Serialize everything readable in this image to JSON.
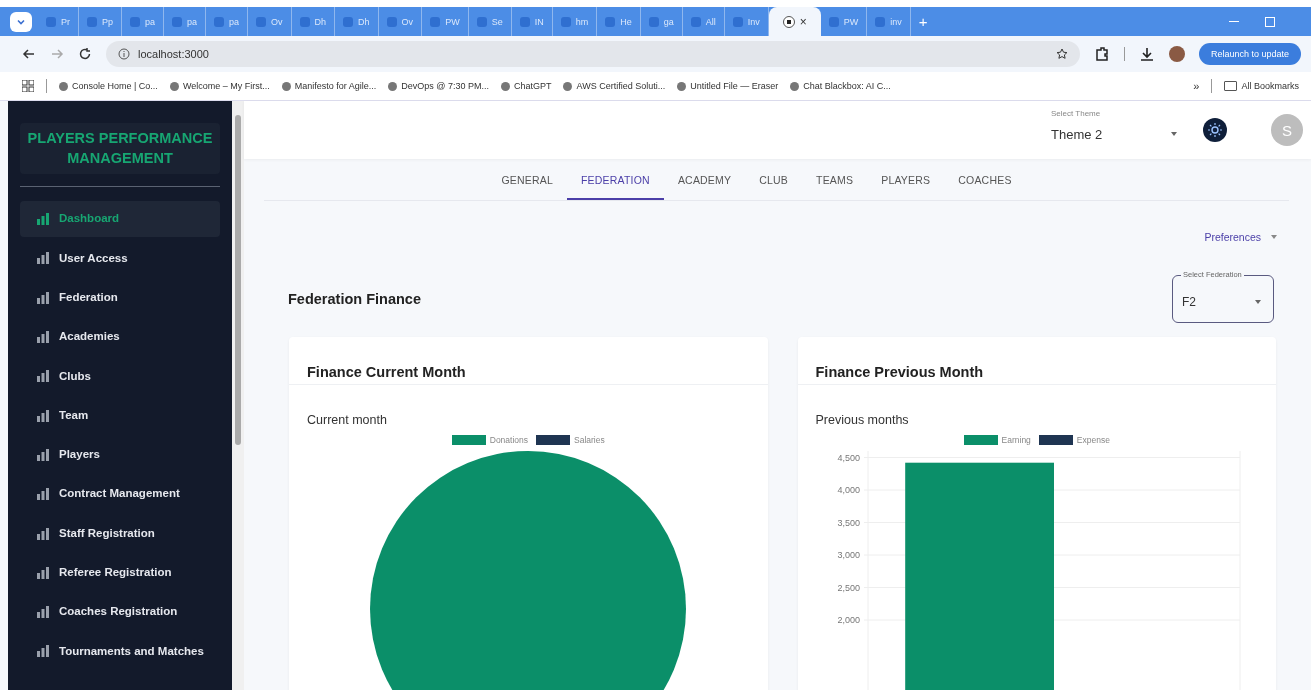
{
  "browser": {
    "tabs": [
      {
        "label": "Pr",
        "selected": false
      },
      {
        "label": "Pp",
        "selected": false
      },
      {
        "label": "pa",
        "selected": false
      },
      {
        "label": "pa",
        "selected": false
      },
      {
        "label": "pa",
        "selected": false
      },
      {
        "label": "Ov",
        "selected": false
      },
      {
        "label": "Dh",
        "selected": false
      },
      {
        "label": "Dh",
        "selected": false
      },
      {
        "label": "Ov",
        "selected": false
      },
      {
        "label": "PW",
        "selected": false
      },
      {
        "label": "Se",
        "selected": false
      },
      {
        "label": "IN",
        "selected": false
      },
      {
        "label": "hm",
        "selected": false
      },
      {
        "label": "He",
        "selected": false
      },
      {
        "label": "ga",
        "selected": false
      },
      {
        "label": "All",
        "selected": false
      },
      {
        "label": "Inv",
        "selected": false
      },
      {
        "close": "×",
        "selected": true
      },
      {
        "label": "PW",
        "selected": false
      },
      {
        "label": "inv",
        "selected": false
      }
    ],
    "new_tab": "+",
    "url": "localhost:3000",
    "relaunch": "Relaunch to update",
    "bookmarks": [
      "Console Home | Co...",
      "Welcome – My First...",
      "Manifesto for Agile...",
      "DevOps @ 7:30 PM...",
      "ChatGPT",
      "AWS Certified Soluti...",
      "Untitled File — Eraser",
      "Chat Blackbox: AI C..."
    ],
    "more": "»",
    "all_bookmarks": "All Bookmarks"
  },
  "sidebar": {
    "title": "PLAYERS PERFORMANCE MANAGEMENT",
    "items": [
      {
        "label": "Dashboard",
        "selected": true
      },
      {
        "label": "User Access",
        "selected": false
      },
      {
        "label": "Federation",
        "selected": false
      },
      {
        "label": "Academies",
        "selected": false
      },
      {
        "label": "Clubs",
        "selected": false
      },
      {
        "label": "Team",
        "selected": false
      },
      {
        "label": "Players",
        "selected": false
      },
      {
        "label": "Contract Management",
        "selected": false
      },
      {
        "label": "Staff Registration",
        "selected": false
      },
      {
        "label": "Referee Registration",
        "selected": false
      },
      {
        "label": "Coaches Registration",
        "selected": false
      },
      {
        "label": "Tournaments and Matches",
        "selected": false
      }
    ]
  },
  "header": {
    "theme_select": {
      "label": "Select Theme",
      "value": "Theme 2"
    },
    "avatar": "S"
  },
  "nav_tabs": [
    {
      "label": "GENERAL",
      "selected": false
    },
    {
      "label": "FEDERATION",
      "selected": true
    },
    {
      "label": "ACADEMY",
      "selected": false
    },
    {
      "label": "CLUB",
      "selected": false
    },
    {
      "label": "TEAMS",
      "selected": false
    },
    {
      "label": "PLAYERS",
      "selected": false
    },
    {
      "label": "COACHES",
      "selected": false
    }
  ],
  "preferences": "Preferences",
  "section_title": "Federation Finance",
  "federation_select": {
    "label": "Select Federation",
    "value": "F2"
  },
  "cards": [
    {
      "title": "Finance Current Month",
      "pie_chart": {
        "title": "Current month",
        "legend": [
          {
            "name": "Donations",
            "color": "#0b8f69"
          },
          {
            "name": "Salaries",
            "color": "#1f3552"
          }
        ]
      }
    },
    {
      "title": "Finance Previous Month",
      "chart_data": {
        "type": "bar",
        "title": "Previous months",
        "ylim": [
          0,
          4600
        ],
        "grid": true,
        "yticks": [
          {
            "value": 2000,
            "label": "2,000"
          },
          {
            "value": 2500,
            "label": "2,500"
          },
          {
            "value": 3000,
            "label": "3,000"
          },
          {
            "value": 3500,
            "label": "3,500"
          },
          {
            "value": 4000,
            "label": "4,000"
          },
          {
            "value": 4500,
            "label": "4,500"
          }
        ],
        "series": [
          {
            "name": "Earning",
            "color": "#0b8f69",
            "values": [
              4420
            ]
          },
          {
            "name": "Expense",
            "color": "#1f3552",
            "values": [
              0
            ]
          }
        ]
      }
    }
  ]
}
